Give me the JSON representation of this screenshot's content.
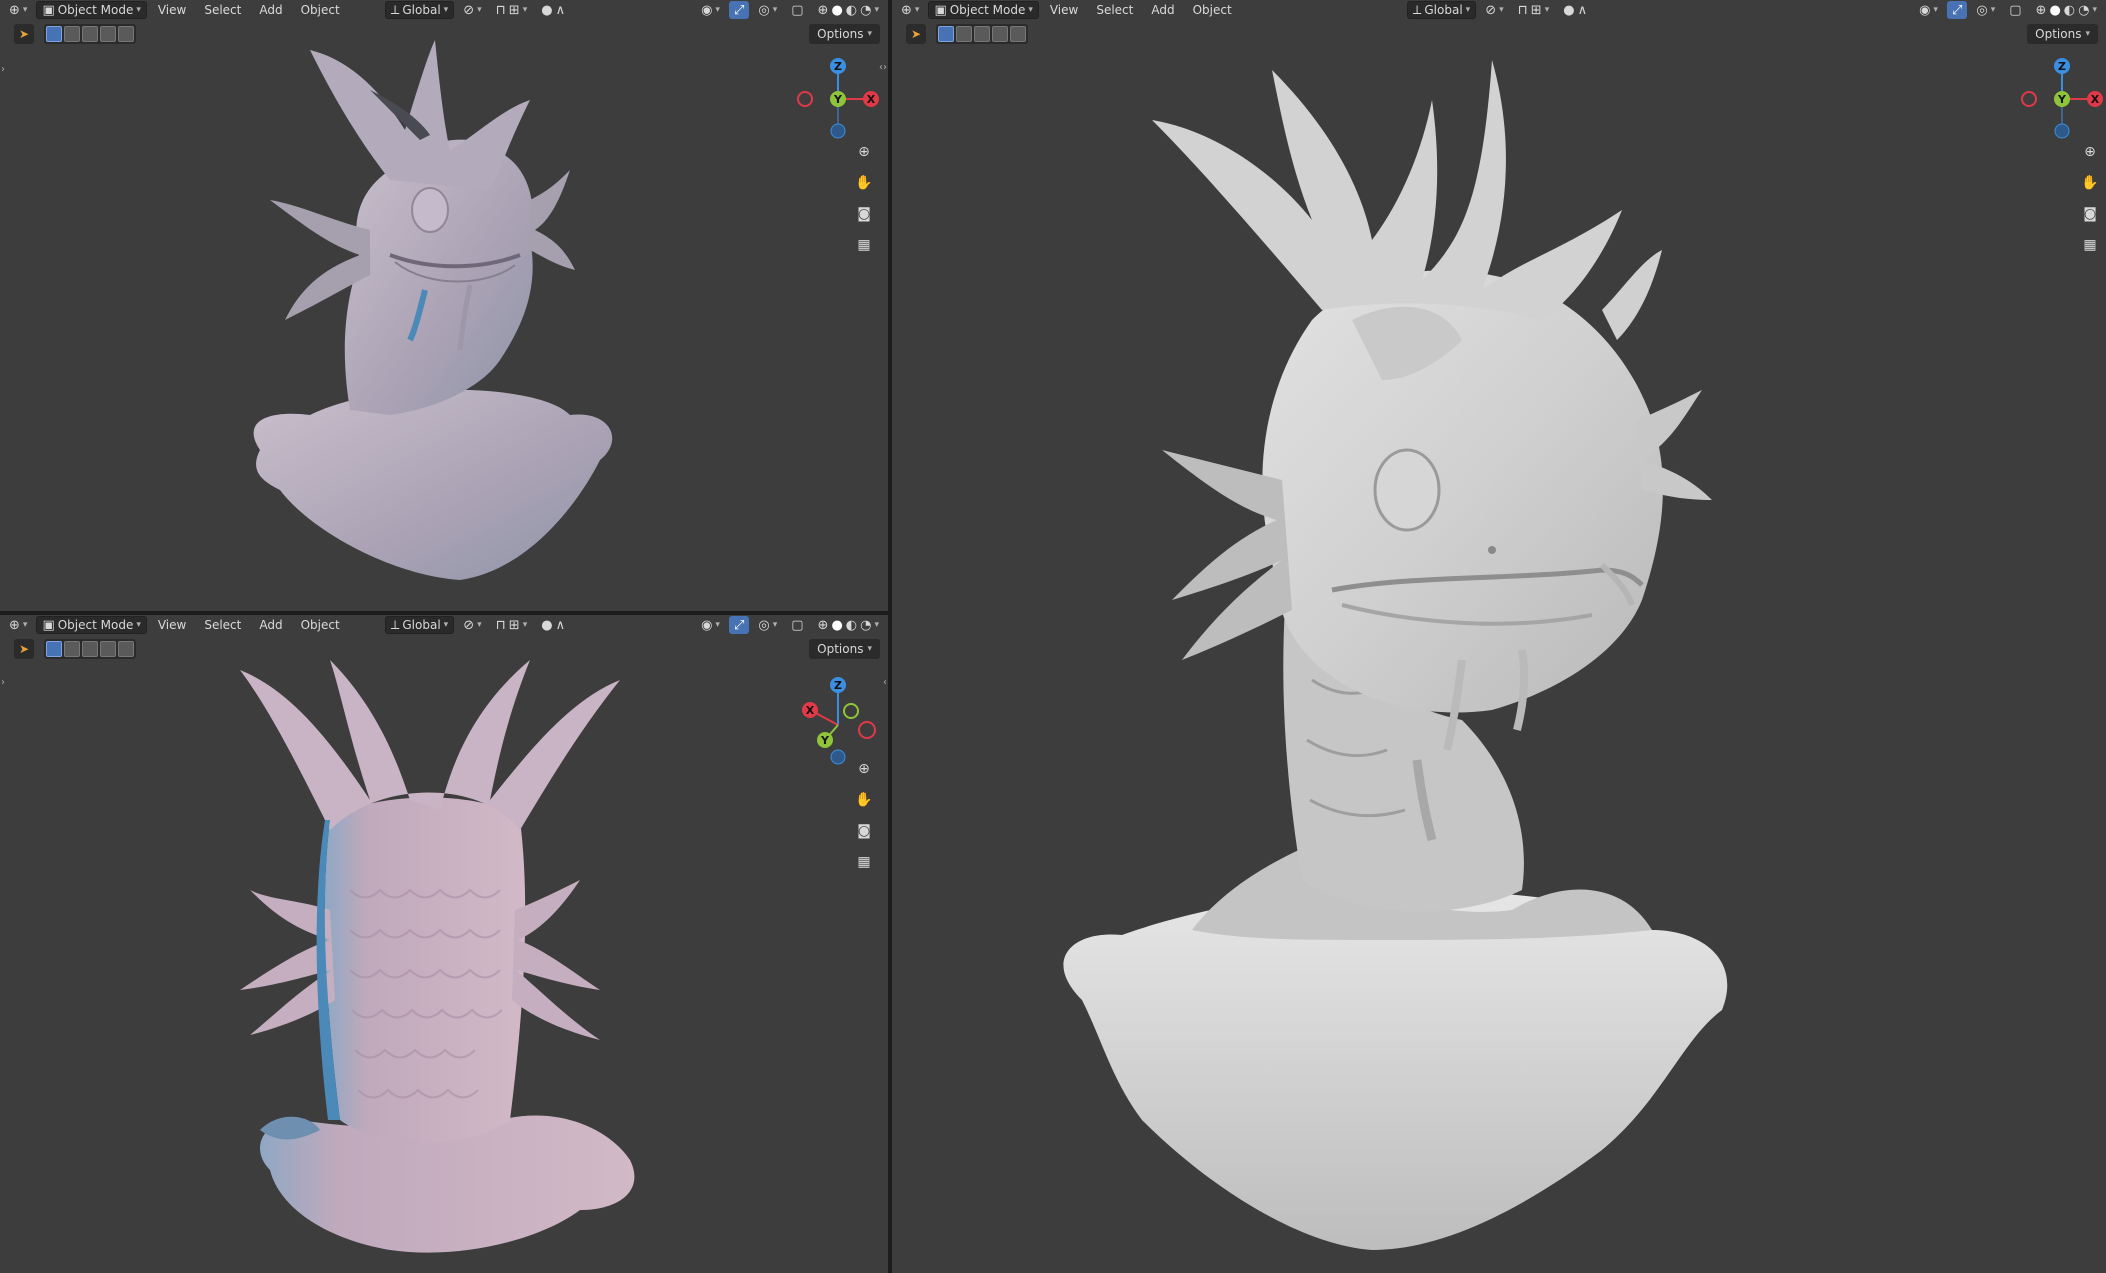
{
  "header": {
    "mode_label": "Object Mode",
    "menus": [
      "View",
      "Select",
      "Add",
      "Object"
    ],
    "orientation_label": "Global",
    "options_label": "Options"
  },
  "gizmo": {
    "z": "Z",
    "y": "Y",
    "x": "X"
  },
  "icons": [
    "editor-type-icon",
    "object-mode-icon",
    "orientation-icon",
    "pivot-icon",
    "snap-icon",
    "snap-increment-icon",
    "proportional-edit-icon",
    "falloff-icon",
    "visibility-icon",
    "gizmo-toggle-icon",
    "overlay-icon",
    "xray-icon",
    "wireframe-shading-icon",
    "solid-shading-icon",
    "material-shading-icon",
    "rendered-shading-icon",
    "zoom-icon",
    "hand-icon",
    "camera-icon",
    "grid-icon"
  ],
  "colors": {
    "viewport_bg": "#3d3d3d",
    "header_active": "#4772b3",
    "axis_x": "#e03a48",
    "axis_y": "#8fc43a",
    "axis_z": "#3a8fe0",
    "tool_select": "#e8a13a"
  },
  "viewports": [
    {
      "name": "top-left",
      "shading": "solid",
      "model_color": "#b7a9b9"
    },
    {
      "name": "bottom-left",
      "shading": "solid",
      "model_color": "#c6aebe"
    },
    {
      "name": "right",
      "shading": "solid",
      "model_color": "#d4d4d4"
    }
  ]
}
